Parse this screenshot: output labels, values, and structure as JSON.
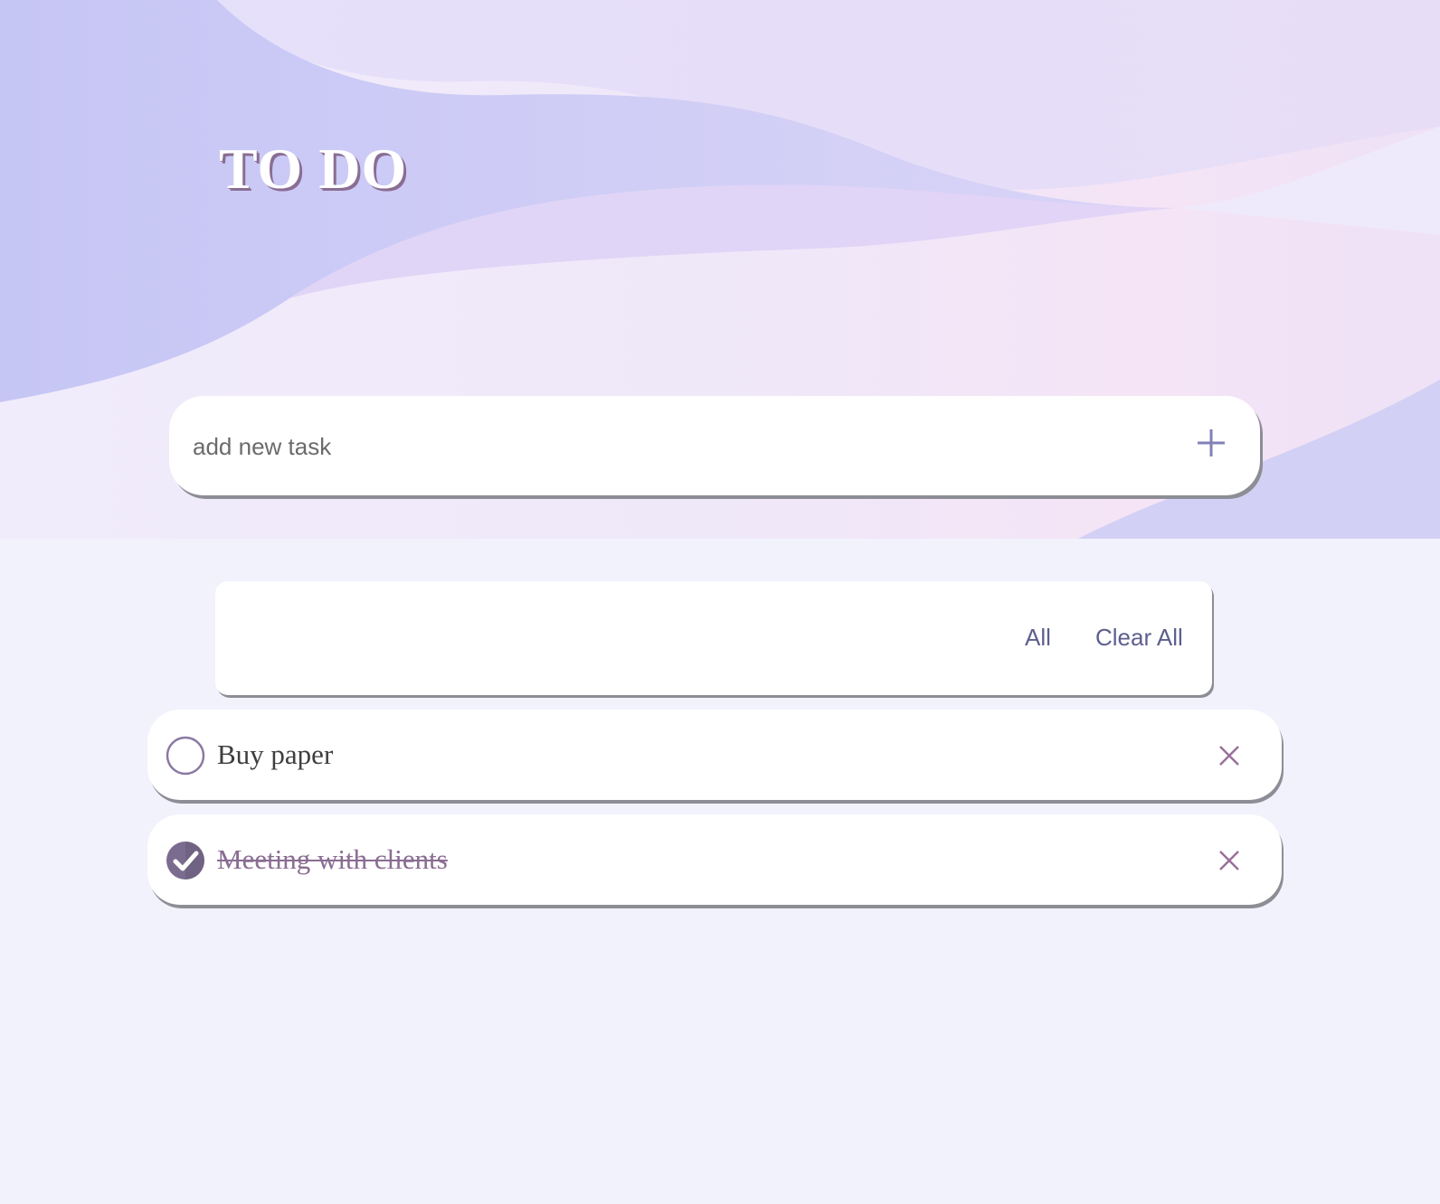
{
  "app": {
    "title": "TO DO"
  },
  "add_task": {
    "placeholder": "add new task",
    "value": "",
    "button_icon": "plus-icon"
  },
  "filters": {
    "all_label": "All",
    "clear_all_label": "Clear All"
  },
  "tasks": [
    {
      "text": "Buy paper",
      "completed": false
    },
    {
      "text": "Meeting with clients",
      "completed": true
    }
  ],
  "colors": {
    "background": "#f2f2fc",
    "accent": "#8a6d93",
    "icon": "#8181b9",
    "link": "#5d5f8e",
    "checked": "#7b6c8f"
  }
}
